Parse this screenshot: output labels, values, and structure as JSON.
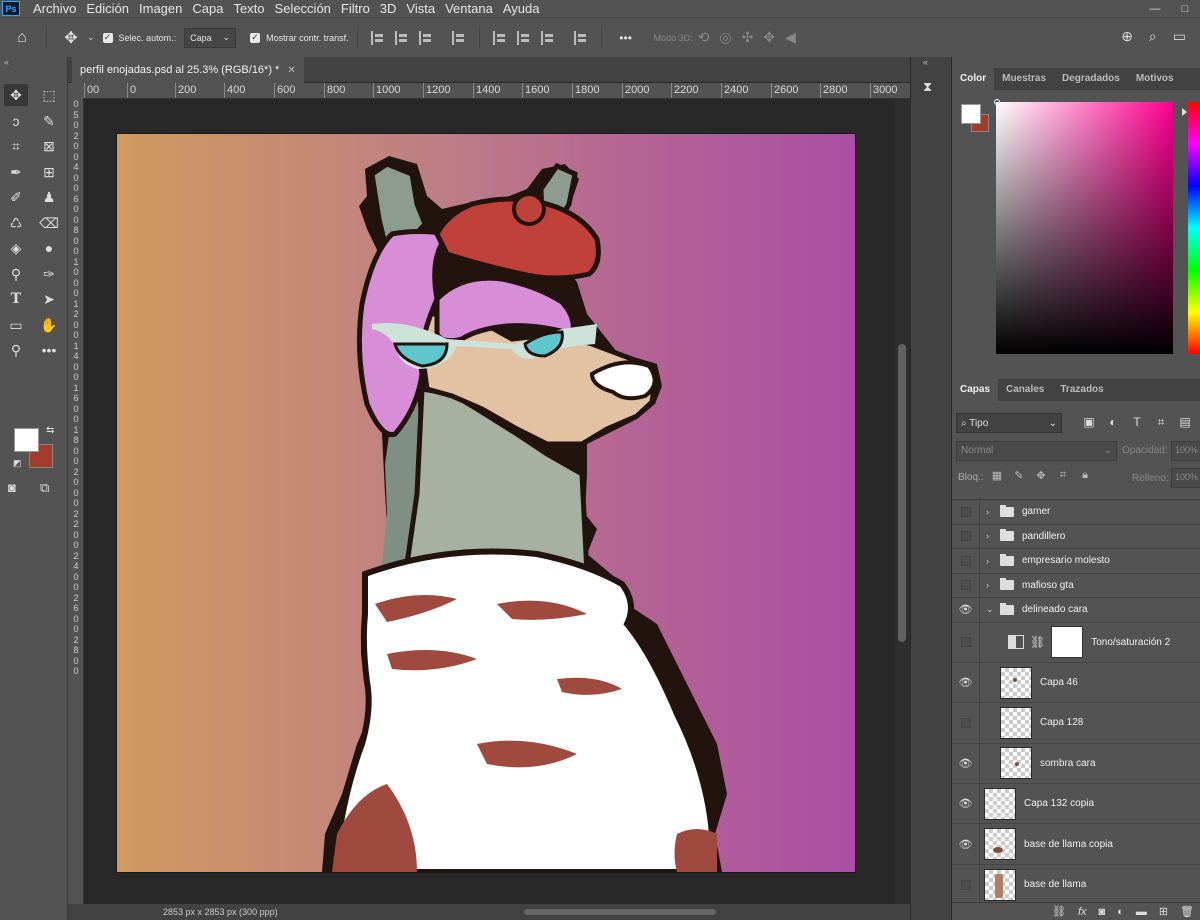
{
  "app": {
    "logo": "Ps"
  },
  "menu": [
    "Archivo",
    "Edición",
    "Imagen",
    "Capa",
    "Texto",
    "Selección",
    "Filtro",
    "3D",
    "Vista",
    "Ventana",
    "Ayuda"
  ],
  "window_controls": [
    "—",
    "□"
  ],
  "options": {
    "auto_select_label": "Selec. autom.:",
    "auto_select_value": "Capa",
    "show_transform_label": "Mostrar contr. transf.",
    "more": "•••",
    "mode3d_label": "Modo 3D:"
  },
  "document": {
    "tab_title": "perfil enojadas.psd al 25.3% (RGB/16*) *",
    "status": "2853 px x 2853 px (300 ppp)",
    "ruler_h": [
      "00",
      "0",
      "200",
      "400",
      "600",
      "800",
      "1000",
      "1200",
      "1400",
      "1600",
      "1800",
      "2000",
      "2200",
      "2400",
      "2600",
      "2800",
      "3000"
    ],
    "ruler_v": "0 5 0 2 0 0 4 0 0 6 0 0 8 0 0 1 0 0 0 1 2 0 0 1 4 0 0 1 6 0 0 1 8 0 0 2 0 0 0 2 2 0 0 2 4 0 0 2 6 0 0 2 8 0 0"
  },
  "color_panel": {
    "tabs": [
      "Color",
      "Muestras",
      "Degradados",
      "Motivos"
    ],
    "active_tab": "Color",
    "foreground": "#ffffff",
    "background": "#a43b2b",
    "hue_color": "#ff0090"
  },
  "layers_panel": {
    "tabs": [
      "Capas",
      "Canales",
      "Trazados"
    ],
    "active_tab": "Capas",
    "filter_label": "Tipo",
    "blend_mode": "Normal",
    "opacity_label": "Opacidad:",
    "opacity_value": "100%",
    "lock_label": "Bloq.:",
    "fill_label": "Relleno:",
    "fill_value": "100%",
    "layers": [
      {
        "name": "gamer",
        "type": "group",
        "visible": false,
        "expanded": false
      },
      {
        "name": "pandillero",
        "type": "group",
        "visible": false,
        "expanded": false
      },
      {
        "name": "empresario molesto",
        "type": "group",
        "visible": false,
        "expanded": false
      },
      {
        "name": "mafioso gta",
        "type": "group",
        "visible": false,
        "expanded": false
      },
      {
        "name": "delineado cara",
        "type": "group",
        "visible": true,
        "expanded": true
      },
      {
        "name": "Tono/saturación 2",
        "type": "adjustment",
        "visible": false
      },
      {
        "name": "Capa 46",
        "type": "layer",
        "visible": true,
        "indent": true
      },
      {
        "name": "Capa 128",
        "type": "layer",
        "visible": false,
        "indent": true
      },
      {
        "name": "sombra cara",
        "type": "layer",
        "visible": true,
        "indent": true
      },
      {
        "name": "Capa 132 copia",
        "type": "layer",
        "visible": true
      },
      {
        "name": "base de llama copia",
        "type": "layer",
        "visible": true
      },
      {
        "name": "base de llama",
        "type": "layer",
        "visible": false
      }
    ]
  }
}
